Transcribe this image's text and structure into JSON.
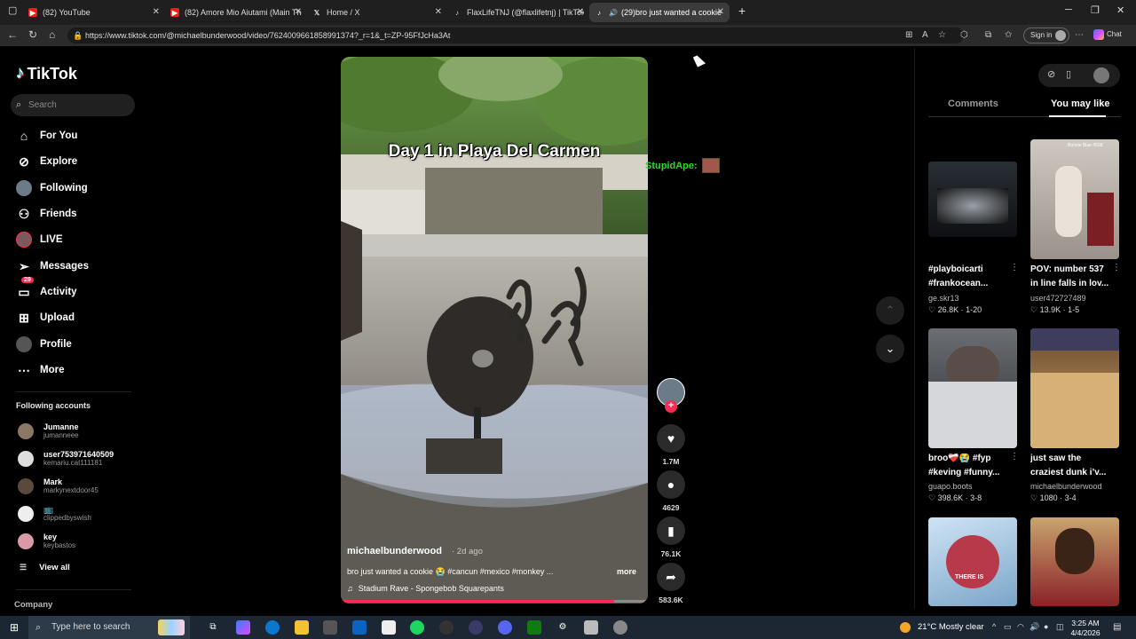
{
  "browser": {
    "tabs": [
      {
        "title": "(82) YouTube",
        "favicon": "youtube-icon"
      },
      {
        "title": "(82) Amore Mio Aiutami (Main The",
        "favicon": "youtube-icon"
      },
      {
        "title": "Home / X",
        "favicon": "x-icon"
      },
      {
        "title": "FlaxLifeTNJ (@flaxlifetnj) | TikTok",
        "favicon": "tiktok-icon"
      },
      {
        "title": "(29)bro just wanted a cookie 😭",
        "favicon": "tiktok-icon",
        "active": true
      }
    ],
    "url": "https://www.tiktok.com/@michaelbunderwood/video/7624009661858991374?_r=1&_t=ZP-95FfJcHa3At",
    "sign_in": "Sign in",
    "chat": "Chat"
  },
  "sidebar": {
    "logo": "TikTok",
    "search_placeholder": "Search",
    "nav": [
      {
        "label": "For You",
        "icon": "home-icon"
      },
      {
        "label": "Explore",
        "icon": "compass-icon"
      },
      {
        "label": "Following",
        "icon": "avatar-icon"
      },
      {
        "label": "Friends",
        "icon": "friends-icon"
      },
      {
        "label": "LIVE",
        "icon": "live-avatar-icon"
      },
      {
        "label": "Messages",
        "icon": "paper-plane-icon"
      },
      {
        "label": "Activity",
        "icon": "inbox-icon",
        "badge": "29"
      },
      {
        "label": "Upload",
        "icon": "plus-square-icon"
      },
      {
        "label": "Profile",
        "icon": "profile-avatar-icon"
      },
      {
        "label": "More",
        "icon": "ellipsis-icon"
      }
    ],
    "following_title": "Following accounts",
    "accounts": [
      {
        "name": "Jumanne",
        "handle": "jumanneee"
      },
      {
        "name": "user753971640509",
        "handle": "kemariu.cat111181"
      },
      {
        "name": "Mark",
        "handle": "markynextdoor45"
      },
      {
        "name": "📺",
        "handle": "clippedbyswish"
      },
      {
        "name": "key",
        "handle": "keybastos"
      }
    ],
    "view_all": "View all",
    "company": "Company"
  },
  "video": {
    "overlay_text": "Day 1 in Playa Del Carmen",
    "author": "michaelbunderwood",
    "time": "· 2d ago",
    "description": "bro just wanted a cookie 😭 #cancun #mexico #monkey ...",
    "more": "more",
    "music": "Stadium Rave - Spongebob Squarepants",
    "progress": 0.89
  },
  "stream_overlay": {
    "username": "StupidApe:"
  },
  "actions": {
    "likes": "1.7M",
    "comments": "4629",
    "saves": "76.1K",
    "shares": "583.6K"
  },
  "right_panel": {
    "tab_comments": "Comments",
    "tab_you_may_like": "You may like",
    "cards": [
      {
        "line1": "#playboicarti",
        "line2": "#frankocean...",
        "author": "ge.skr13",
        "likes": "26.8K",
        "duration": "1-20"
      },
      {
        "line1": "POV: number 537",
        "line2": "in line falls in lov...",
        "author": "user472727489",
        "likes": "13.9K",
        "duration": "1-5",
        "thumb_text": "Bonnie Blue #538"
      },
      {
        "line1": "broo❤️‍🩹😭 #fyp",
        "line2": "#keving #funny...",
        "author": "guapo.boots",
        "likes": "398.6K",
        "duration": "3-8"
      },
      {
        "line1": "just saw the",
        "line2": "craziest dunk i’v...",
        "author": "michaelbunderwood",
        "likes": "1080",
        "duration": "3-4"
      },
      {
        "line1": "",
        "line2": "",
        "author": "",
        "likes": "",
        "duration": "",
        "thumb_text": "THERE IS"
      },
      {
        "line1": "",
        "line2": "",
        "author": "",
        "likes": "",
        "duration": ""
      }
    ]
  },
  "taskbar": {
    "search_placeholder": "Type here to search",
    "weather": "21°C  Mostly clear",
    "time": "3:25 AM",
    "date": "4/4/2026"
  },
  "colors": {
    "accent": "#fe2c55",
    "overlay_green": "#2bd92b"
  }
}
